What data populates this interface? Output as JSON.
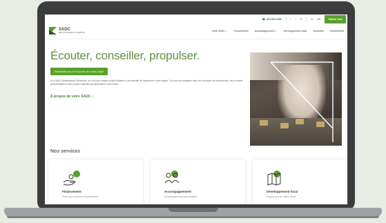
{
  "topbar": {
    "phone": "819 843-7866",
    "social_f": "f",
    "social_in": "in",
    "social_x": "⊕",
    "lang": "EN",
    "cta": "Obtenir mon"
  },
  "header": {
    "logo_name": "SADC",
    "logo_tagline": "BELLECHASSE-ETCHEMINS",
    "nav": [
      "Votre SADC ⌄",
      "Financement",
      "Accompagnement ⌄",
      "Développement local",
      "Nouvelles",
      "Événements"
    ]
  },
  "hero": {
    "title": "Écouter, conseiller, propulser.",
    "button": "Ensemble pour le succès de votre projet",
    "text": "À la SADC Bellechasse-Etchemins, on croit que chaque projet d'affaires a le potentiel de transformer notre région. On vous accompagne avec des solutions de financement, des conseils personnalisés et des projets collectifs qui dynamisent notre milieu.",
    "link": "À propos de votre SADC ›"
  },
  "services": {
    "title": "Nos services",
    "cards": [
      {
        "title": "Financement",
        "sub": "Prêts pour soutenir le financement",
        "icon": "hand-money-icon"
      },
      {
        "title": "Accompagnement",
        "sub": "Accompagnement personnalisé",
        "icon": "people-icon"
      },
      {
        "title": "Développement local",
        "sub": "Projets pour un milieu vivant",
        "icon": "map-icon"
      }
    ]
  },
  "colors": {
    "accent": "#5aa02c",
    "dark_green": "#2f5d24",
    "title_green": "#5e8f3e"
  }
}
